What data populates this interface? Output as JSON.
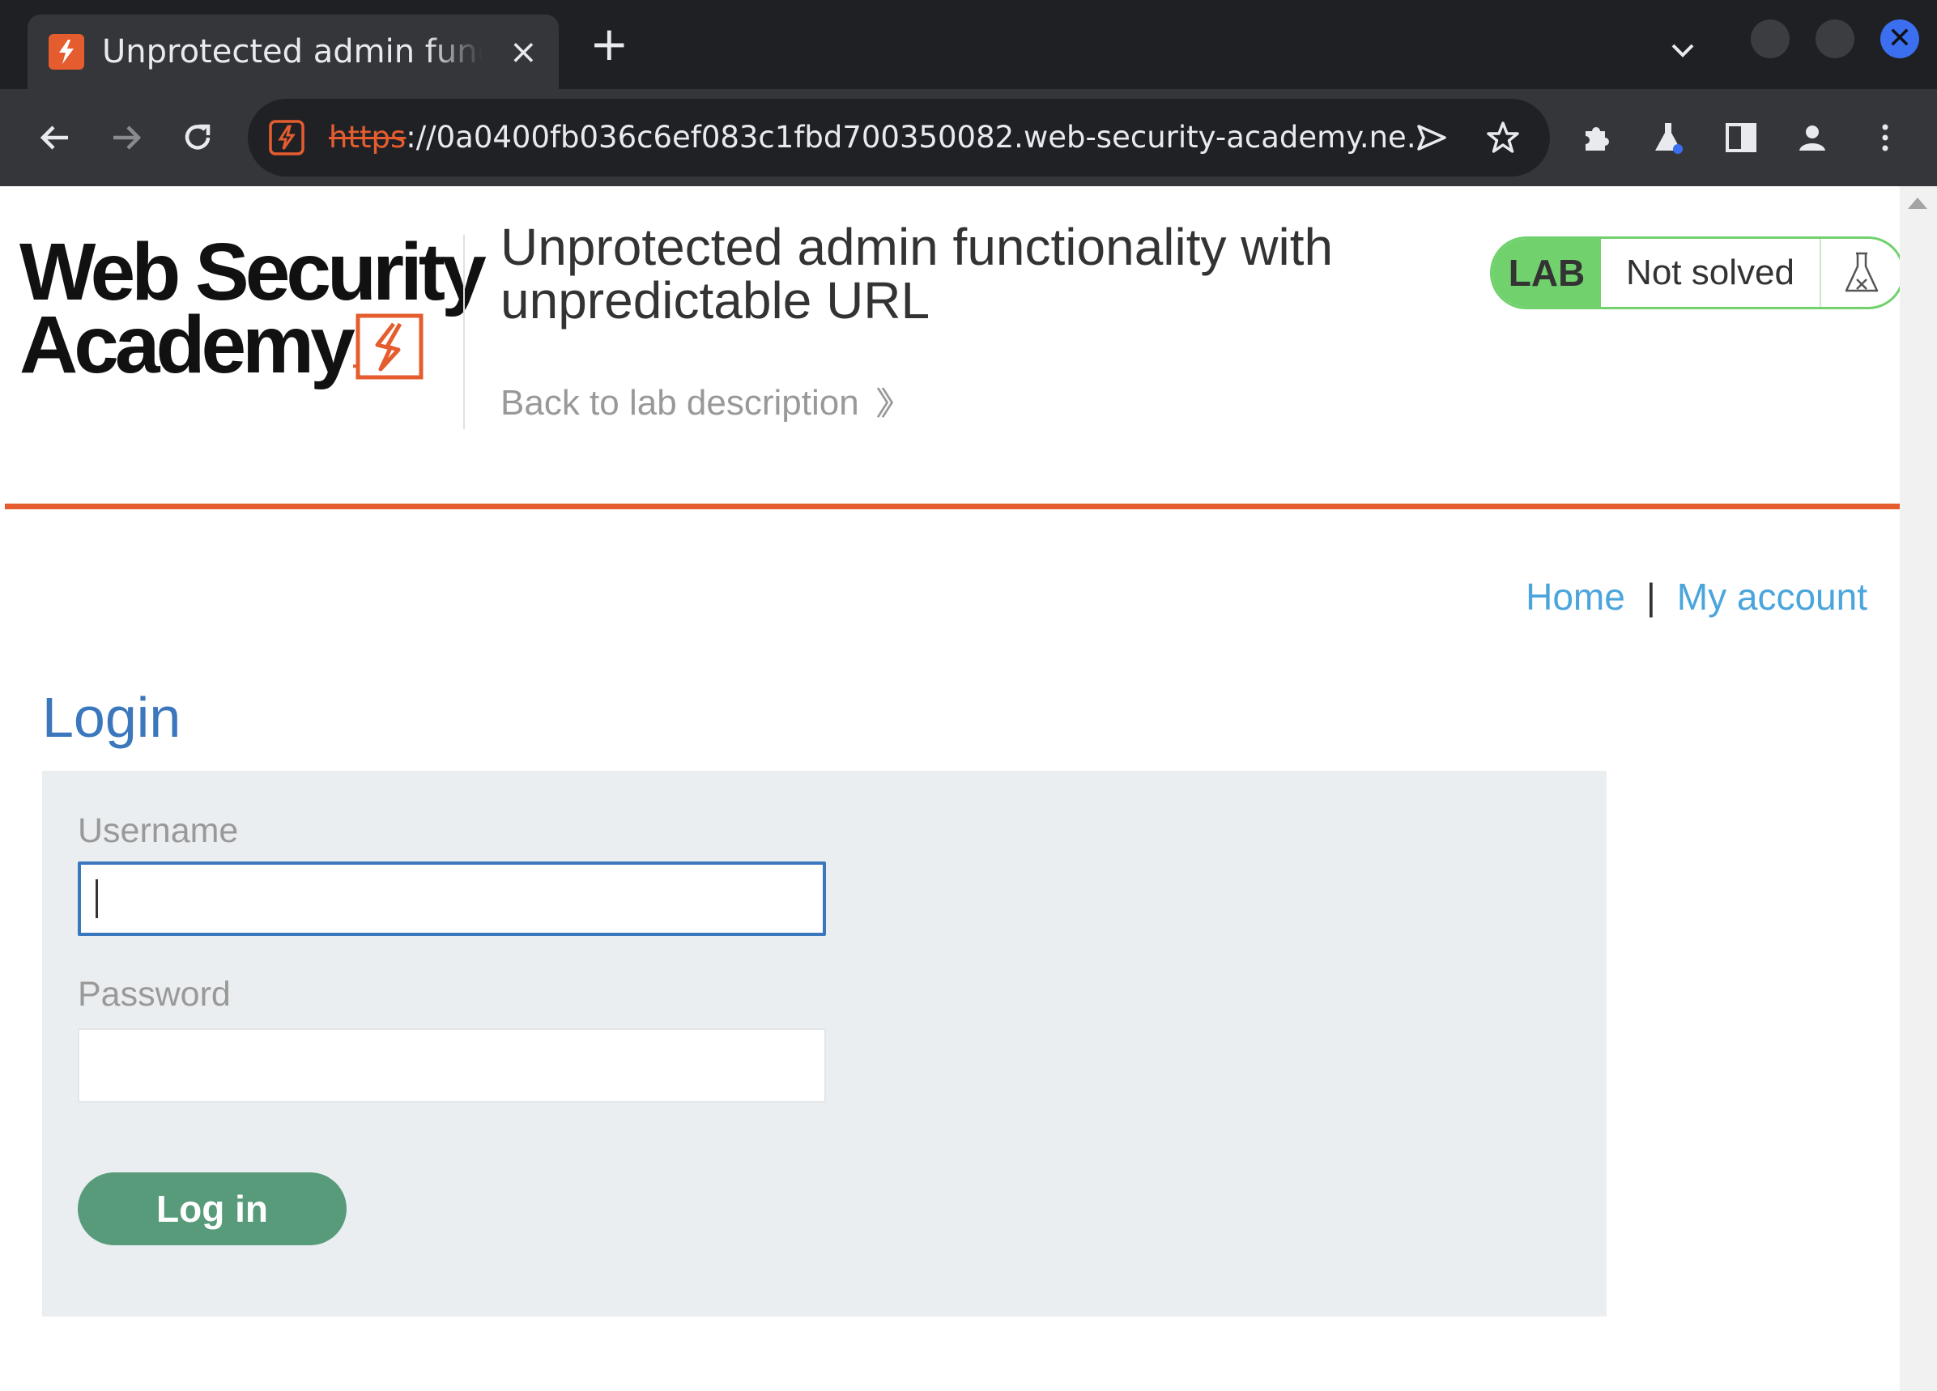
{
  "browser": {
    "tab_title": "Unprotected admin functionality with unpredictable URL",
    "tab_close_glyph": "×",
    "new_tab_glyph": "+",
    "close_window_glyph": "✕",
    "url_scheme": "https",
    "url_rest": "://0a0400fb036c6ef083c1fbd700350082.web-security-academy.ne...",
    "icons": [
      "back-icon",
      "forward-icon",
      "reload-icon",
      "site-info-icon",
      "send-icon",
      "bookmark-star-icon",
      "extensions-icon",
      "labs-flask-icon",
      "side-panel-icon",
      "profile-icon",
      "menu-icon"
    ]
  },
  "header": {
    "logo_line1": "Web Security",
    "logo_line2": "Academy",
    "lab_title": "Unprotected admin functionality with unpredictable URL",
    "back_link": "Back to lab description",
    "back_chevron": "»",
    "lab_badge": "LAB",
    "lab_status": "Not solved",
    "accent_color": "#e55d2f",
    "status_color": "#70d16d"
  },
  "nav": {
    "home": "Home",
    "separator": "|",
    "my_account": "My account"
  },
  "login": {
    "heading": "Login",
    "username_label": "Username",
    "username_value": "",
    "password_label": "Password",
    "password_value": "",
    "submit_label": "Log in"
  }
}
